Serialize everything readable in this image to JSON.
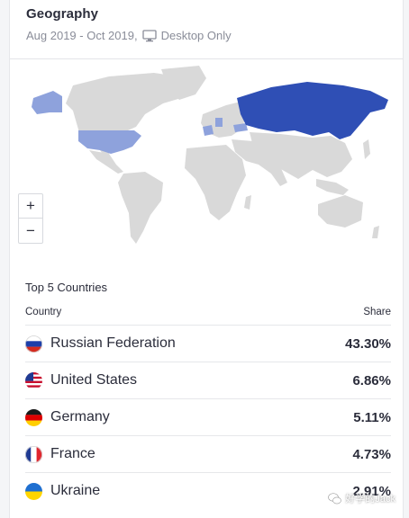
{
  "header": {
    "title": "Geography",
    "date_range": "Aug 2019 - Oct 2019,",
    "device": "Desktop Only"
  },
  "map": {
    "zoom_in": "+",
    "zoom_out": "−",
    "land_color": "#d9d9d9",
    "highlight_strong": "#2f4fb5",
    "highlight_light": "#8ea2dc"
  },
  "top_countries": {
    "title": "Top 5 Countries",
    "col_country": "Country",
    "col_share": "Share",
    "rows": [
      {
        "country": "Russian Federation",
        "share": "43.30%",
        "flag": "russia-flag"
      },
      {
        "country": "United States",
        "share": "6.86%",
        "flag": "usa-flag"
      },
      {
        "country": "Germany",
        "share": "5.11%",
        "flag": "germany-flag"
      },
      {
        "country": "France",
        "share": "4.73%",
        "flag": "france-flag"
      },
      {
        "country": "Ukraine",
        "share": "2.91%",
        "flag": "ukraine-flag"
      }
    ]
  },
  "watermark": {
    "text": "好学的Jack",
    "icon": "wechat-icon"
  }
}
